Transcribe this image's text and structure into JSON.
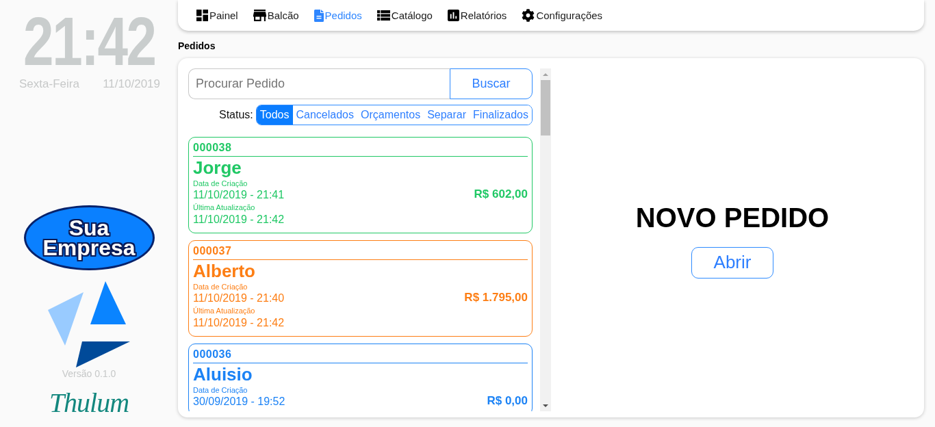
{
  "sidebar": {
    "clock": "21:42",
    "weekday": "Sexta-Feira",
    "date": "11/10/2019",
    "company_logo": "Sua Empresa",
    "version": "Versão 0.1.0",
    "brand": "Thulum"
  },
  "nav": {
    "items": [
      {
        "label": "Painel",
        "selected": false
      },
      {
        "label": "Balcão",
        "selected": false
      },
      {
        "label": "Pedidos",
        "selected": true
      },
      {
        "label": "Catálogo",
        "selected": false
      },
      {
        "label": "Relatórios",
        "selected": false
      },
      {
        "label": "Configurações",
        "selected": false
      }
    ]
  },
  "page_title": "Pedidos",
  "search": {
    "placeholder": "Procurar Pedido",
    "button": "Buscar"
  },
  "status_filter": {
    "label": "Status:",
    "options": [
      {
        "label": "Todos",
        "selected": true
      },
      {
        "label": "Cancelados",
        "selected": false
      },
      {
        "label": "Orçamentos",
        "selected": false
      },
      {
        "label": "Separar",
        "selected": false
      },
      {
        "label": "Finalizados",
        "selected": false
      }
    ]
  },
  "orders": [
    {
      "number": "000038",
      "customer": "Jorge",
      "created_label": "Data de Criação",
      "created": "11/10/2019 - 21:41",
      "updated_label": "Última Atualização",
      "updated": "11/10/2019 - 21:42",
      "total": "R$ 602,00",
      "color": "#20c865"
    },
    {
      "number": "000037",
      "customer": "Alberto",
      "created_label": "Data de Criação",
      "created": "11/10/2019 - 21:40",
      "updated_label": "Última Atualização",
      "updated": "11/10/2019 - 21:42",
      "total": "R$ 1.795,00",
      "color": "#fd7e14"
    },
    {
      "number": "000036",
      "customer": "Aluisio",
      "created_label": "Data de Criação",
      "created": "30/09/2019 - 19:52",
      "total": "R$ 0,00",
      "color": "#1b82f5"
    }
  ],
  "new_order": {
    "title": "NOVO PEDIDO",
    "button": "Abrir"
  }
}
